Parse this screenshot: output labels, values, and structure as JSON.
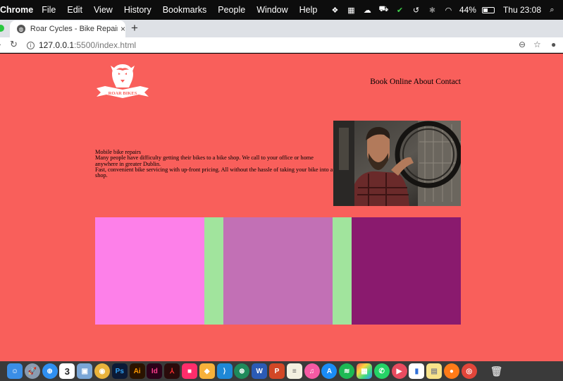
{
  "menubar": {
    "app_name": "Chrome",
    "menus": [
      "File",
      "Edit",
      "View",
      "History",
      "Bookmarks",
      "People",
      "Window",
      "Help"
    ],
    "battery_percent": "44%",
    "battery_level": 0.44,
    "clock": "Thu 23:08"
  },
  "browser": {
    "tab_title": "Roar Cycles - Bike Repairs in D",
    "url_host": "127.0.0.1",
    "url_path": ":5500/index.html"
  },
  "page": {
    "background": "#f95f5b",
    "logo_text": "ROAR BIKES",
    "nav": [
      "Book Online",
      "About",
      "Contact"
    ],
    "hero": {
      "heading": "Mobile bike repairs",
      "paragraph1": "Many people have difficulty getting their bikes to a bike shop. We call to your office or home anywhere in greater Dublin.",
      "paragraph2": "Fast, convenient bike servicing with up-front pricing. All without the hassle of taking your bike into a shop."
    },
    "blocks": [
      {
        "color": "#fd80e9"
      },
      {
        "color": "#a1e49d"
      },
      {
        "color": "#c270b5"
      },
      {
        "color": "#a1e49d"
      },
      {
        "color": "#8a1a6e"
      }
    ]
  },
  "dock": {
    "icons": [
      "finder-icon",
      "launchpad-icon",
      "safari-icon",
      "calendar-icon",
      "preview-icon",
      "chrome-canary-icon",
      "photoshop-icon",
      "illustrator-icon",
      "indesign-icon",
      "acrobat-icon",
      "pink-app-icon",
      "sketch-icon",
      "vscode-icon",
      "sourcetree-icon",
      "word-icon",
      "powerpoint-icon",
      "notes-icon",
      "itunes-icon",
      "app-store-icon",
      "spotify-icon",
      "colors-icon",
      "whatsapp-icon",
      "paw-icon",
      "stats-icon",
      "stickies-icon",
      "firefox-icon",
      "chrome-icon",
      "trash-icon"
    ],
    "calendar_day": "3",
    "labels": {
      "photoshop": "Ps",
      "illustrator": "Ai",
      "indesign": "Id",
      "word": "W",
      "powerpoint": "P"
    }
  }
}
